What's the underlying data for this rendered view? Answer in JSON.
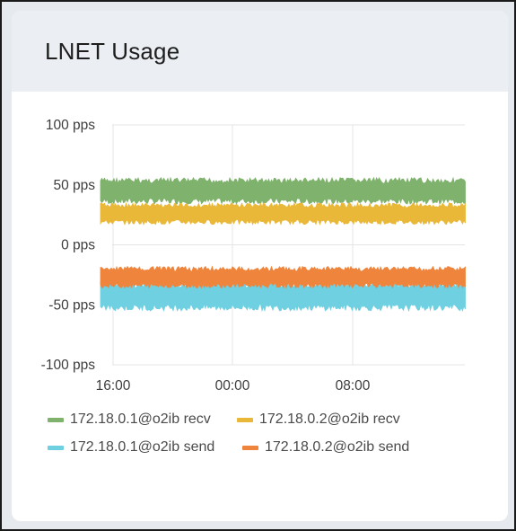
{
  "panel": {
    "title": "LNET Usage"
  },
  "chart_data": {
    "type": "line",
    "title": "LNET Usage",
    "xlabel": "",
    "ylabel": "",
    "x_tick_labels": [
      "16:00",
      "00:00",
      "08:00"
    ],
    "y_ticks": [
      100,
      50,
      0,
      -50,
      -100
    ],
    "y_tick_labels": [
      "100 pps",
      "50 pps",
      "0 pps",
      "-50 pps",
      "-100 pps"
    ],
    "ylim": [
      -100,
      100
    ],
    "grid": true,
    "legend_position": "bottom",
    "series": [
      {
        "name": "172.18.0.1@o2ib recv",
        "color": "#7eb26d",
        "mean": 45,
        "min": 34,
        "max": 56
      },
      {
        "name": "172.18.0.2@o2ib recv",
        "color": "#eab839",
        "mean": 25,
        "min": 17,
        "max": 35
      },
      {
        "name": "172.18.0.1@o2ib send",
        "color": "#6ed0e0",
        "mean": -42,
        "min": -55,
        "max": -30
      },
      {
        "name": "172.18.0.2@o2ib send",
        "color": "#ef843c",
        "mean": -25,
        "min": -36,
        "max": -18
      }
    ]
  }
}
